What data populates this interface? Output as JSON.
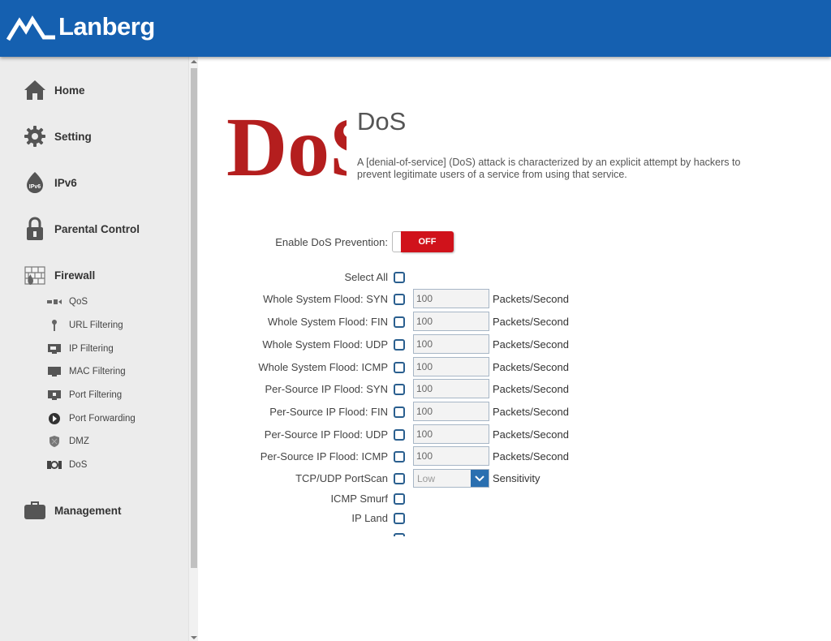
{
  "header": {
    "brand": "Lanberg"
  },
  "sidebar": {
    "main_items": [
      {
        "label": "Home",
        "icon": "home-icon"
      },
      {
        "label": "Setting",
        "icon": "gear-icon"
      },
      {
        "label": "IPv6",
        "icon": "ipv6-icon",
        "icon_text": "IPv6"
      },
      {
        "label": "Parental Control",
        "icon": "lock-icon"
      },
      {
        "label": "Firewall",
        "icon": "firewall-icon"
      },
      {
        "label": "Management",
        "icon": "briefcase-icon"
      }
    ],
    "sub_items": [
      {
        "label": "QoS",
        "icon": "qos-icon"
      },
      {
        "label": "URL Filtering",
        "icon": "url-filter-icon"
      },
      {
        "label": "IP Filtering",
        "icon": "ip-filter-icon"
      },
      {
        "label": "MAC Filtering",
        "icon": "mac-filter-icon"
      },
      {
        "label": "Port Filtering",
        "icon": "port-filter-icon"
      },
      {
        "label": "Port Forwarding",
        "icon": "port-forward-icon"
      },
      {
        "label": "DMZ",
        "icon": "dmz-icon"
      },
      {
        "label": "DoS",
        "icon": "dos-icon"
      }
    ]
  },
  "page": {
    "title": "DoS",
    "logo_text": "DoS",
    "description": "A [denial-of-service] (DoS) attack is characterized by an explicit attempt by hackers to prevent legitimate users of a service from using that service.",
    "enable_label": "Enable DoS Prevention:",
    "toggle_state": "OFF",
    "select_all_label": "Select All",
    "unit_label": "Packets/Second",
    "flood_rows": [
      {
        "label": "Whole System Flood: SYN",
        "value": "100"
      },
      {
        "label": "Whole System Flood: FIN",
        "value": "100"
      },
      {
        "label": "Whole System Flood: UDP",
        "value": "100"
      },
      {
        "label": "Whole System Flood: ICMP",
        "value": "100"
      },
      {
        "label": "Per-Source IP Flood: SYN",
        "value": "100"
      },
      {
        "label": "Per-Source IP Flood: FIN",
        "value": "100"
      },
      {
        "label": "Per-Source IP Flood: UDP",
        "value": "100"
      },
      {
        "label": "Per-Source IP Flood: ICMP",
        "value": "100"
      }
    ],
    "portscan": {
      "label": "TCP/UDP PortScan",
      "selected": "Low",
      "suffix": "Sensitivity"
    },
    "icmp_smurf_label": "ICMP Smurf",
    "ip_land_label": "IP Land"
  },
  "colors": {
    "header": "#1560b0",
    "toggle_off": "#d0121b",
    "checkbox_border": "#2a5f8f"
  }
}
